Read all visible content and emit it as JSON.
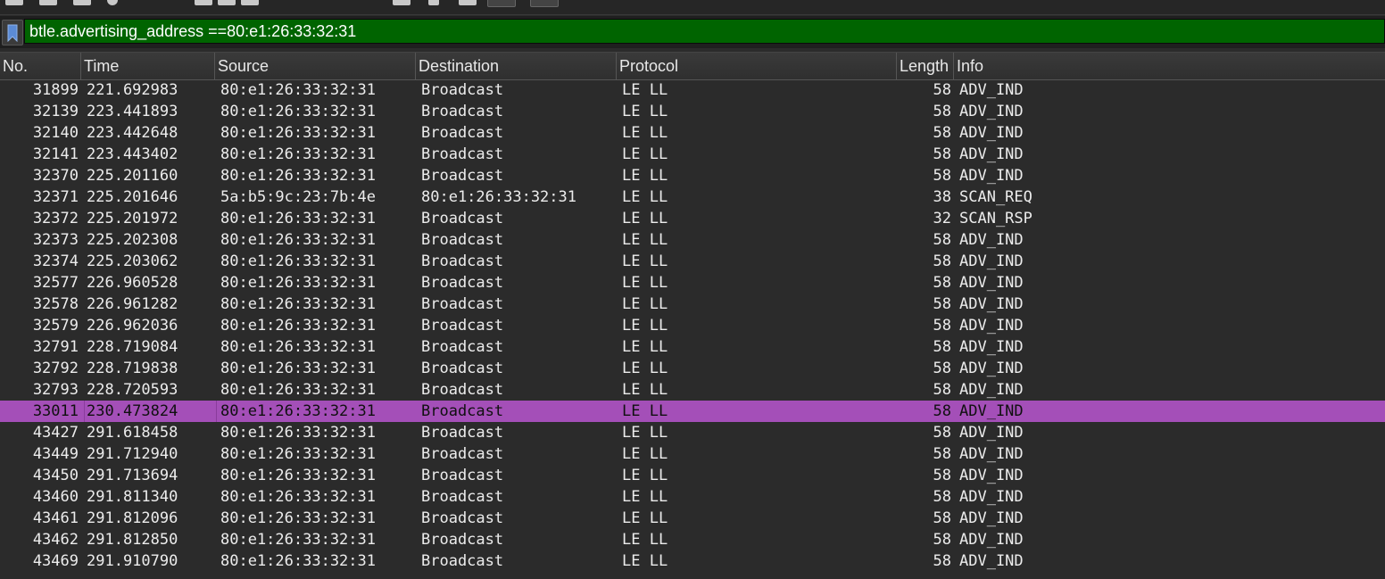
{
  "filter": {
    "value": "btle.advertising_address ==80:e1:26:33:32:31"
  },
  "columns": {
    "no": "No.",
    "time": "Time",
    "source": "Source",
    "destination": "Destination",
    "protocol": "Protocol",
    "length": "Length",
    "info": "Info"
  },
  "colors": {
    "filter_valid_bg": "#006400",
    "selected_row_bg": "#a44fb8",
    "background": "#2b2b2b"
  },
  "packets": [
    {
      "no": "31899",
      "time": "221.692983",
      "source": "80:e1:26:33:32:31",
      "destination": "Broadcast",
      "protocol": "LE LL",
      "length": "58",
      "info": "ADV_IND"
    },
    {
      "no": "32139",
      "time": "223.441893",
      "source": "80:e1:26:33:32:31",
      "destination": "Broadcast",
      "protocol": "LE LL",
      "length": "58",
      "info": "ADV_IND"
    },
    {
      "no": "32140",
      "time": "223.442648",
      "source": "80:e1:26:33:32:31",
      "destination": "Broadcast",
      "protocol": "LE LL",
      "length": "58",
      "info": "ADV_IND"
    },
    {
      "no": "32141",
      "time": "223.443402",
      "source": "80:e1:26:33:32:31",
      "destination": "Broadcast",
      "protocol": "LE LL",
      "length": "58",
      "info": "ADV_IND"
    },
    {
      "no": "32370",
      "time": "225.201160",
      "source": "80:e1:26:33:32:31",
      "destination": "Broadcast",
      "protocol": "LE LL",
      "length": "58",
      "info": "ADV_IND"
    },
    {
      "no": "32371",
      "time": "225.201646",
      "source": "5a:b5:9c:23:7b:4e",
      "destination": "80:e1:26:33:32:31",
      "protocol": "LE LL",
      "length": "38",
      "info": "SCAN_REQ"
    },
    {
      "no": "32372",
      "time": "225.201972",
      "source": "80:e1:26:33:32:31",
      "destination": "Broadcast",
      "protocol": "LE LL",
      "length": "32",
      "info": "SCAN_RSP"
    },
    {
      "no": "32373",
      "time": "225.202308",
      "source": "80:e1:26:33:32:31",
      "destination": "Broadcast",
      "protocol": "LE LL",
      "length": "58",
      "info": "ADV_IND"
    },
    {
      "no": "32374",
      "time": "225.203062",
      "source": "80:e1:26:33:32:31",
      "destination": "Broadcast",
      "protocol": "LE LL",
      "length": "58",
      "info": "ADV_IND"
    },
    {
      "no": "32577",
      "time": "226.960528",
      "source": "80:e1:26:33:32:31",
      "destination": "Broadcast",
      "protocol": "LE LL",
      "length": "58",
      "info": "ADV_IND"
    },
    {
      "no": "32578",
      "time": "226.961282",
      "source": "80:e1:26:33:32:31",
      "destination": "Broadcast",
      "protocol": "LE LL",
      "length": "58",
      "info": "ADV_IND"
    },
    {
      "no": "32579",
      "time": "226.962036",
      "source": "80:e1:26:33:32:31",
      "destination": "Broadcast",
      "protocol": "LE LL",
      "length": "58",
      "info": "ADV_IND"
    },
    {
      "no": "32791",
      "time": "228.719084",
      "source": "80:e1:26:33:32:31",
      "destination": "Broadcast",
      "protocol": "LE LL",
      "length": "58",
      "info": "ADV_IND"
    },
    {
      "no": "32792",
      "time": "228.719838",
      "source": "80:e1:26:33:32:31",
      "destination": "Broadcast",
      "protocol": "LE LL",
      "length": "58",
      "info": "ADV_IND"
    },
    {
      "no": "32793",
      "time": "228.720593",
      "source": "80:e1:26:33:32:31",
      "destination": "Broadcast",
      "protocol": "LE LL",
      "length": "58",
      "info": "ADV_IND"
    },
    {
      "no": "33011",
      "time": "230.473824",
      "source": "80:e1:26:33:32:31",
      "destination": "Broadcast",
      "protocol": "LE LL",
      "length": "58",
      "info": "ADV_IND",
      "selected": true
    },
    {
      "no": "43427",
      "time": "291.618458",
      "source": "80:e1:26:33:32:31",
      "destination": "Broadcast",
      "protocol": "LE LL",
      "length": "58",
      "info": "ADV_IND"
    },
    {
      "no": "43449",
      "time": "291.712940",
      "source": "80:e1:26:33:32:31",
      "destination": "Broadcast",
      "protocol": "LE LL",
      "length": "58",
      "info": "ADV_IND"
    },
    {
      "no": "43450",
      "time": "291.713694",
      "source": "80:e1:26:33:32:31",
      "destination": "Broadcast",
      "protocol": "LE LL",
      "length": "58",
      "info": "ADV_IND"
    },
    {
      "no": "43460",
      "time": "291.811340",
      "source": "80:e1:26:33:32:31",
      "destination": "Broadcast",
      "protocol": "LE LL",
      "length": "58",
      "info": "ADV_IND"
    },
    {
      "no": "43461",
      "time": "291.812096",
      "source": "80:e1:26:33:32:31",
      "destination": "Broadcast",
      "protocol": "LE LL",
      "length": "58",
      "info": "ADV_IND"
    },
    {
      "no": "43462",
      "time": "291.812850",
      "source": "80:e1:26:33:32:31",
      "destination": "Broadcast",
      "protocol": "LE LL",
      "length": "58",
      "info": "ADV_IND"
    },
    {
      "no": "43469",
      "time": "291.910790",
      "source": "80:e1:26:33:32:31",
      "destination": "Broadcast",
      "protocol": "LE LL",
      "length": "58",
      "info": "ADV_IND"
    }
  ]
}
